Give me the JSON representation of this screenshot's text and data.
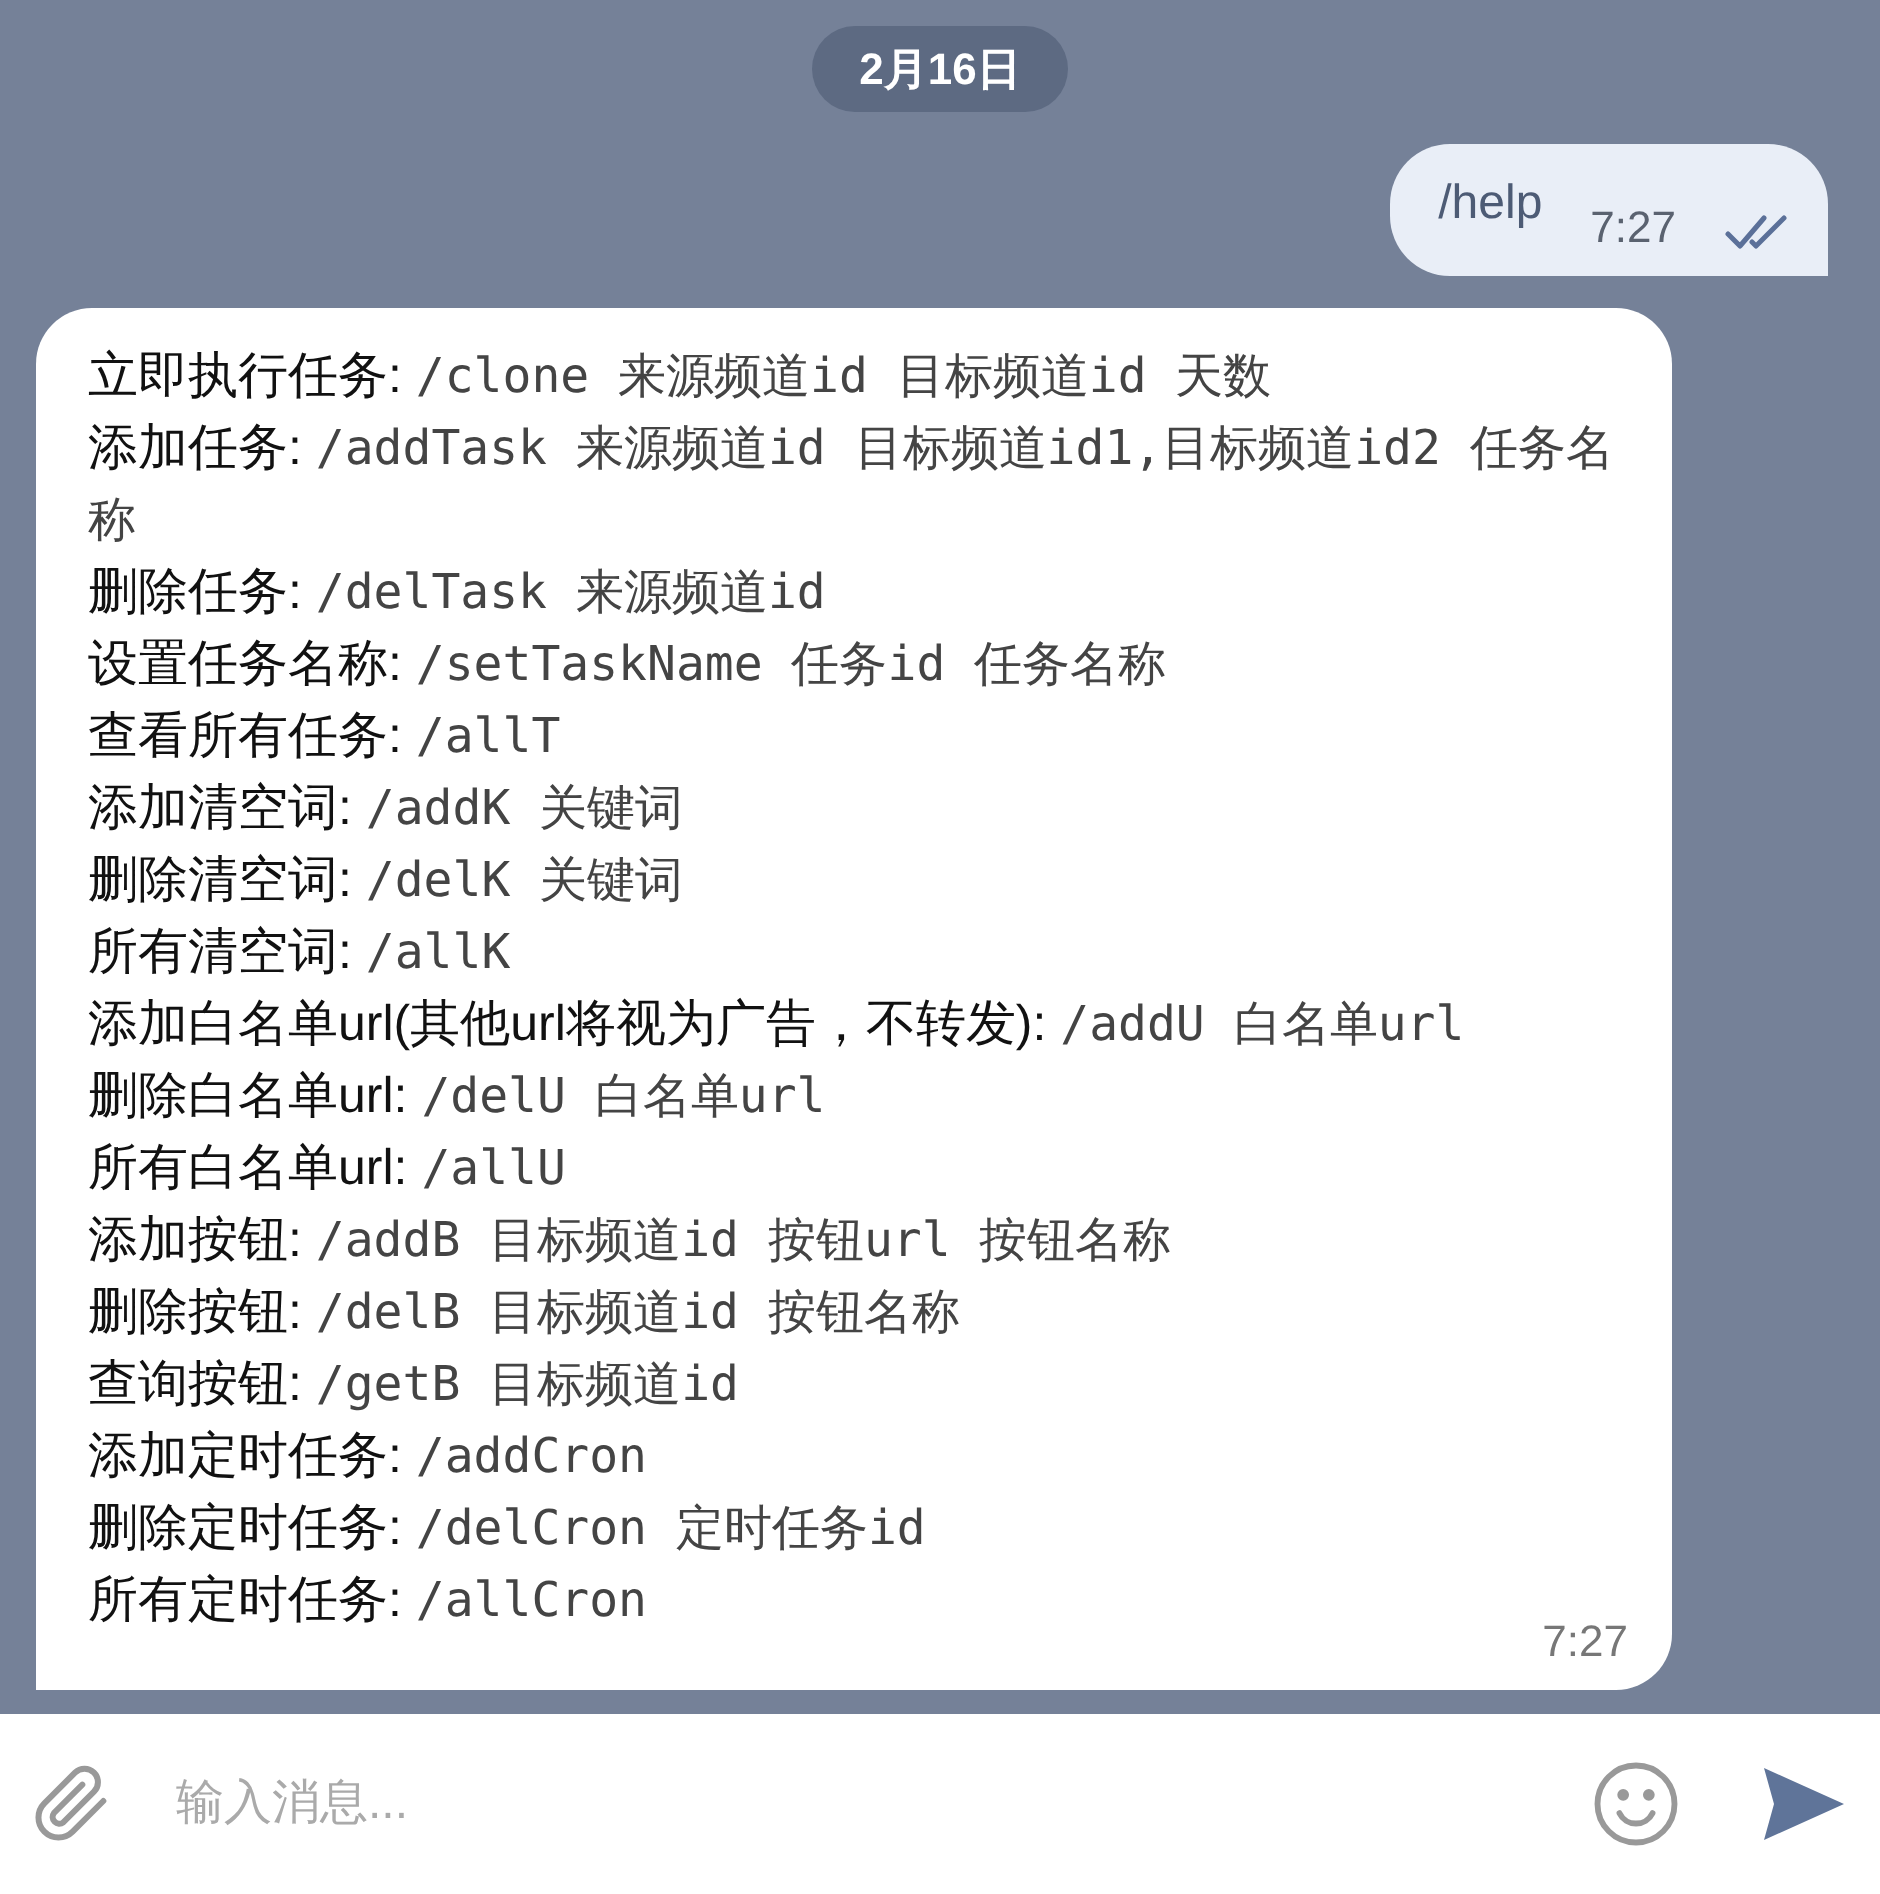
{
  "date_badge": "2月16日",
  "sent_message": {
    "text": "/help",
    "time": "7:27",
    "read": true
  },
  "received_message": {
    "lines": [
      {
        "label": "立即执行任务:",
        "command": "/clone 来源频道id 目标频道id 天数"
      },
      {
        "label": "添加任务:",
        "command": "/addTask 来源频道id 目标频道id1,目标频道id2 任务名称"
      },
      {
        "label": "删除任务:",
        "command": "/delTask 来源频道id"
      },
      {
        "label": "设置任务名称:",
        "command": "/setTaskName 任务id 任务名称"
      },
      {
        "label": "查看所有任务:",
        "command": "/allT"
      },
      {
        "label": "添加清空词:",
        "command": "/addK 关键词"
      },
      {
        "label": "删除清空词:",
        "command": "/delK 关键词"
      },
      {
        "label": "所有清空词:",
        "command": "/allK"
      },
      {
        "label": "添加白名单url(其他url将视为广告，不转发):",
        "command": "/addU 白名单url"
      },
      {
        "label": "删除白名单url:",
        "command": "/delU 白名单url"
      },
      {
        "label": "所有白名单url:",
        "command": "/allU"
      },
      {
        "label": "添加按钮:",
        "command": "/addB 目标频道id 按钮url 按钮名称"
      },
      {
        "label": "删除按钮:",
        "command": "/delB 目标频道id 按钮名称"
      },
      {
        "label": "查询按钮:",
        "command": "/getB 目标频道id"
      },
      {
        "label": "添加定时任务:",
        "command": "/addCron"
      },
      {
        "label": "删除定时任务:",
        "command": "/delCron 定时任务id"
      },
      {
        "label": "所有定时任务:",
        "command": "/allCron"
      }
    ],
    "time": "7:27"
  },
  "composer": {
    "placeholder": "输入消息..."
  }
}
